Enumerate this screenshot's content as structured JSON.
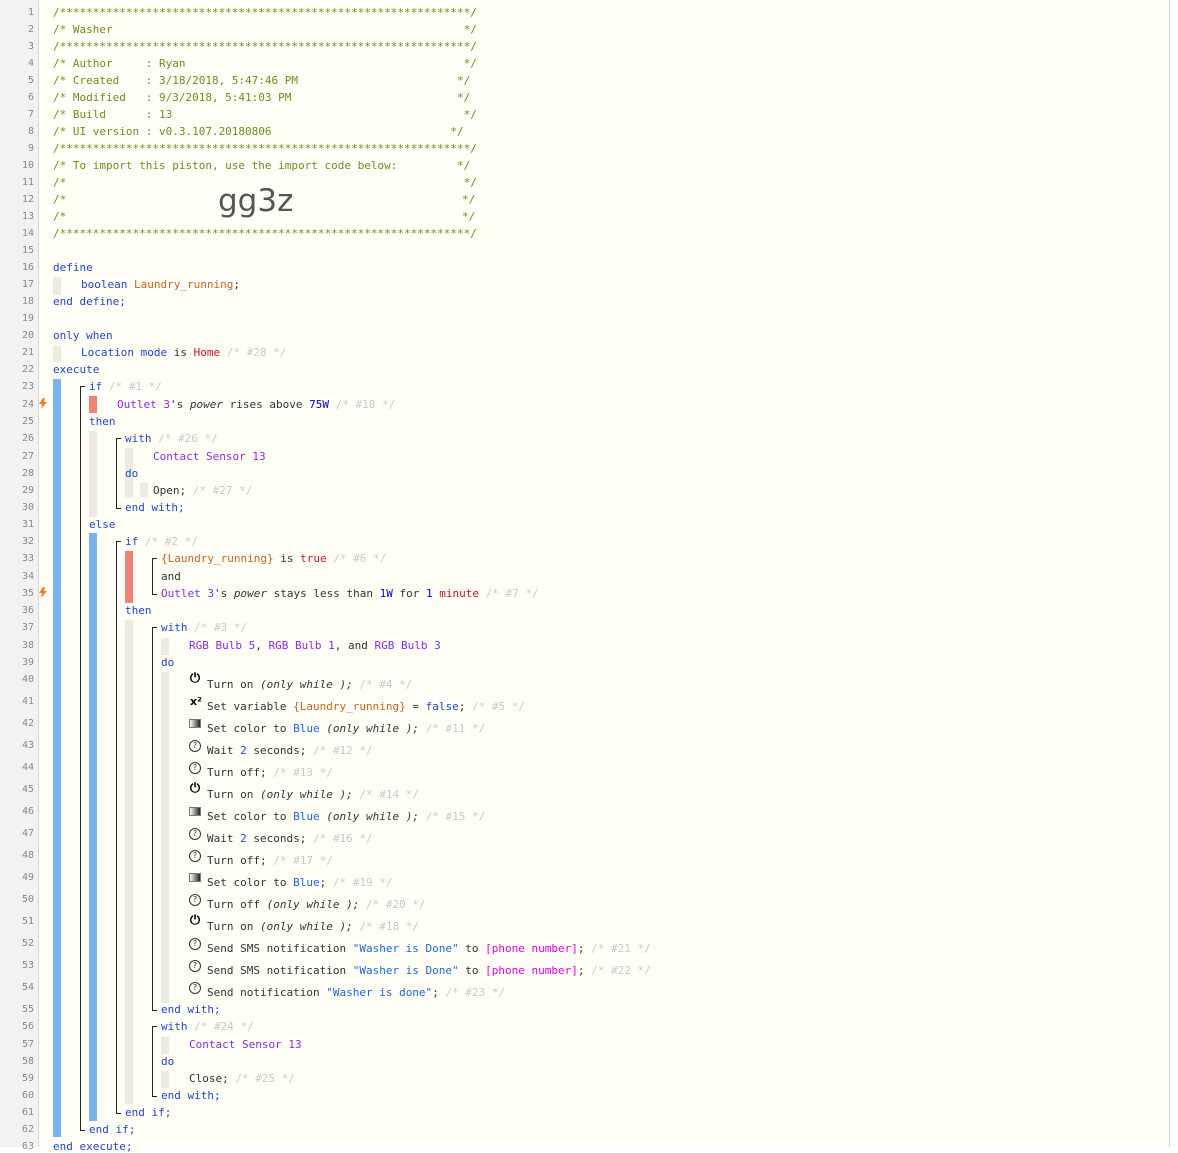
{
  "line_numbers": [
    "1",
    "2",
    "3",
    "4",
    "5",
    "6",
    "7",
    "8",
    "9",
    "10",
    "11",
    "12",
    "13",
    "14",
    "15",
    "16",
    "17",
    "18",
    "19",
    "20",
    "21",
    "22",
    "23",
    "24",
    "25",
    "26",
    "27",
    "28",
    "29",
    "30",
    "31",
    "32",
    "33",
    "34",
    "35",
    "36",
    "37",
    "38",
    "39",
    "40",
    "41",
    "42",
    "43",
    "44",
    "45",
    "46",
    "47",
    "48",
    "49",
    "50",
    "51",
    "52",
    "53",
    "54",
    "55",
    "56",
    "57",
    "58",
    "59",
    "60",
    "61",
    "62",
    "63"
  ],
  "header": {
    "border": "/**************************************************************/",
    "title": "/* Washer                                                     */",
    "author": "/* Author     : Ryan                                          */",
    "created": "/* Created    : 3/18/2018, 5:47:46 PM                        */",
    "modified": "/* Modified   : 9/3/2018, 5:41:03 PM                         */",
    "build": "/* Build      : 13                                            */",
    "ui_version": "/* UI version : v0.3.107.20180806                           */",
    "import_text": "/* To import this piston, use the import code below:         */",
    "blank": "/*                                                            */",
    "blank_open": "/*",
    "blank_close": "*/",
    "import_code": "gg3z"
  },
  "code": {
    "define": "define",
    "boolean": "boolean",
    "laundry_var": "Laundry_running",
    "semicolon": ";",
    "end_define": "end define;",
    "only_when": "only when",
    "location_mode": "Location mode",
    "is": "is",
    "home": "Home",
    "c28": "/* #28 */",
    "execute": "execute",
    "if": "if",
    "c1": "/* #1 */",
    "outlet3": "Outlet 3",
    "s": "'s",
    "power": "power",
    "rises_above": "rises above",
    "w75": "75W",
    "c10": "/* #10 */",
    "then": "then",
    "with": "with",
    "c26": "/* #26 */",
    "contact_sensor": "Contact Sensor 13",
    "do": "do",
    "open": "Open;",
    "c27": "/* #27 */",
    "end_with": "end with;",
    "else": "else",
    "c2": "/* #2 */",
    "laundry_braced": "{Laundry_running}",
    "true": "true",
    "c6": "/* #6 */",
    "and": "and",
    "stays_less": "stays less than",
    "w1": "1W",
    "for": "for",
    "one": "1",
    "minute": "minute",
    "c7": "/* #7 */",
    "c3": "/* #3 */",
    "bulb5": "RGB Bulb 5",
    "comma": ",",
    "bulb1": "RGB Bulb 1",
    "and_word": ", and",
    "bulb3": "RGB Bulb 3",
    "turn_on": "Turn on",
    "only_while": "(only while );",
    "c4": "/* #4 */",
    "set_variable": "Set variable",
    "eq": "=",
    "false": "false",
    "c5": "/* #5 */",
    "set_color_to": "Set color to",
    "blue": "Blue",
    "c11": "/* #11 */",
    "wait": "Wait",
    "two": "2",
    "seconds": "seconds;",
    "c12": "/* #12 */",
    "turn_off": "Turn off;",
    "c13": "/* #13 */",
    "c14": "/* #14 */",
    "c15": "/* #15 */",
    "c16": "/* #16 */",
    "c17": "/* #17 */",
    "c19": "/* #19 */",
    "turn_off_plain": "Turn off",
    "c20": "/* #20 */",
    "c18": "/* #18 */",
    "send_sms": "Send SMS notification",
    "washer_done_q": "\"Washer is Done\"",
    "to": "to",
    "phone": "[phone number]",
    "c21": "/* #21 */",
    "c22": "/* #22 */",
    "send_notification": "Send notification",
    "washer_done_lower": "\"Washer is done\"",
    "c23": "/* #23 */",
    "c24": "/* #24 */",
    "close": "Close;",
    "c25": "/* #25 */",
    "end_if": "end if;",
    "end_execute": "end execute;"
  },
  "icons": {
    "power": "⏻",
    "variable": "x²",
    "help": "?",
    "color": "color-swatch",
    "trigger": "lightning-bolt"
  },
  "colors": {
    "comment_header": "#6b8e23",
    "keyword": "#2244c8",
    "device": "#8a2be2",
    "variable": "#c8641e",
    "block_bar": "#79b3e8",
    "condition_bar": "#f08376",
    "trigger_icon": "#f08030"
  }
}
